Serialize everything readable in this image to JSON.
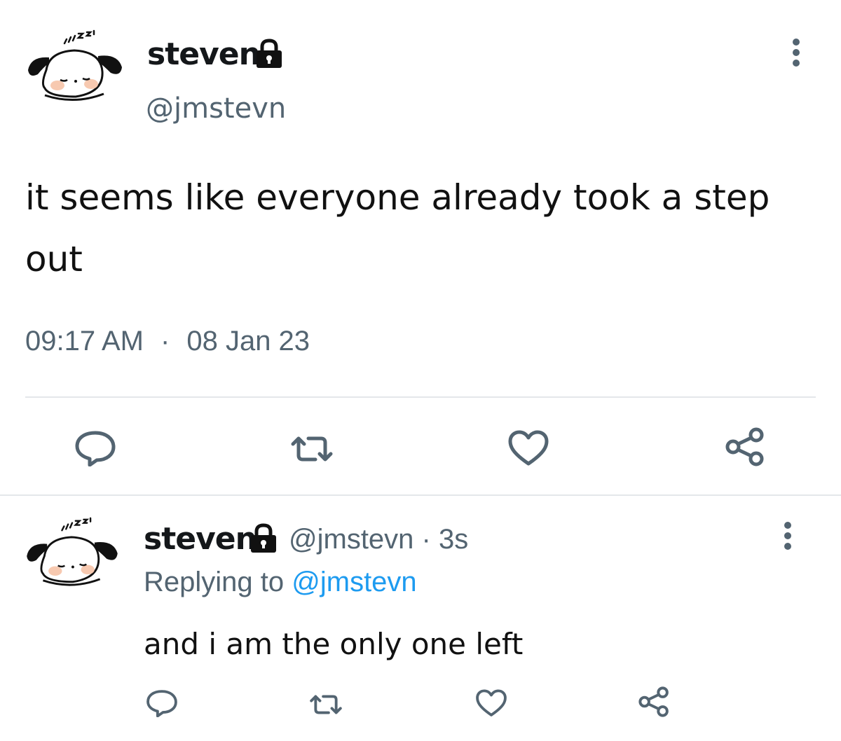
{
  "colors": {
    "text": "#111111",
    "secondary": "#536471",
    "link": "#1d9bf0",
    "divider": "#e4e7ea",
    "icon": "#536471"
  },
  "main_tweet": {
    "display_name": "steven",
    "handle": "@jmstevn",
    "text": "it seems like everyone already took a step out",
    "time": "09:17 AM",
    "separator": "·",
    "date": "08 Jan 23",
    "icons": [
      "avatar-dog-icon",
      "lock-icon",
      "more-vertical-icon",
      "reply-icon",
      "retweet-icon",
      "like-icon",
      "share-icon"
    ]
  },
  "reply_tweet": {
    "display_name": "steven",
    "handle_time": "@jmstevn · 3s",
    "replying_prefix": "Replying to",
    "replying_mention": "@jmstevn",
    "text": "and i am the only one left",
    "icons": [
      "avatar-dog-icon",
      "lock-icon",
      "more-vertical-icon",
      "reply-icon",
      "retweet-icon",
      "like-icon",
      "share-icon"
    ]
  }
}
